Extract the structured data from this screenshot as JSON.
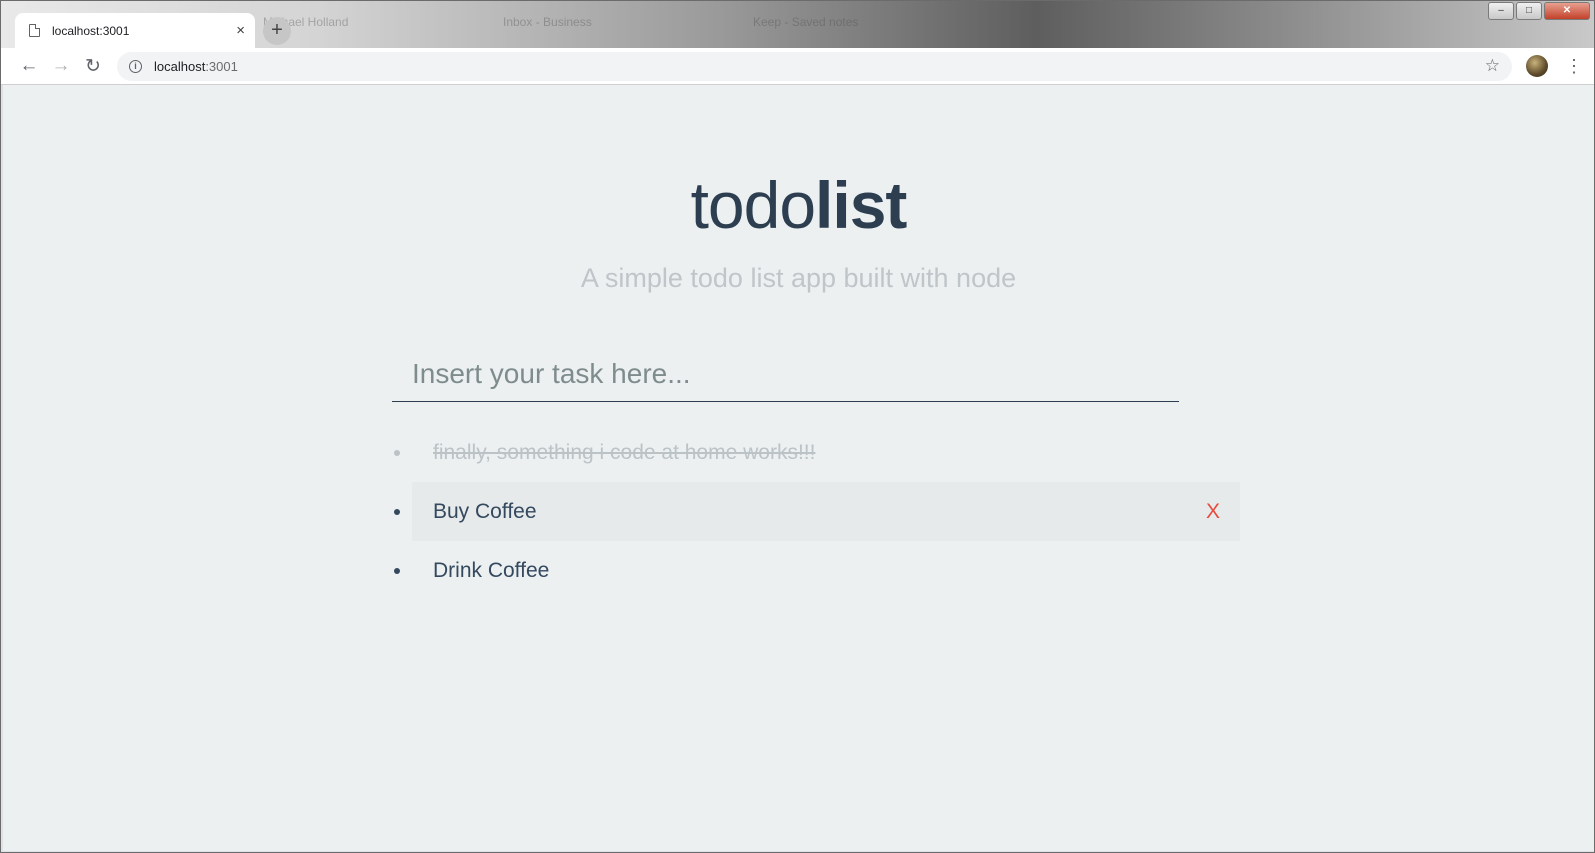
{
  "browser": {
    "tab_title": "localhost:3001",
    "tab_close": "×",
    "new_tab": "+",
    "bg_tab_1": "Michael Holland",
    "bg_tab_2": "Inbox - Business",
    "bg_tab_3": "Keep - Saved notes",
    "url_host": "localhost",
    "url_port": ":3001",
    "back": "←",
    "forward": "→",
    "reload": "↻",
    "star": "☆",
    "menu": "⋮",
    "win_min": "–",
    "win_max": "□",
    "win_close": "✕"
  },
  "app": {
    "title_light": "todo",
    "title_bold": "list",
    "subtitle": "A simple todo list app built with node",
    "input_placeholder": "Insert your task here...",
    "input_value": "",
    "delete_label": "X"
  },
  "todos": [
    {
      "text": "finally, something i code at home works!!!",
      "done": true
    },
    {
      "text": "Buy Coffee",
      "done": false
    },
    {
      "text": "Drink Coffee",
      "done": false
    }
  ],
  "colors": {
    "title": "#2c3e50",
    "subtitle": "#bfc5c9",
    "background": "#ecf0f1",
    "delete": "#e74c3c"
  }
}
